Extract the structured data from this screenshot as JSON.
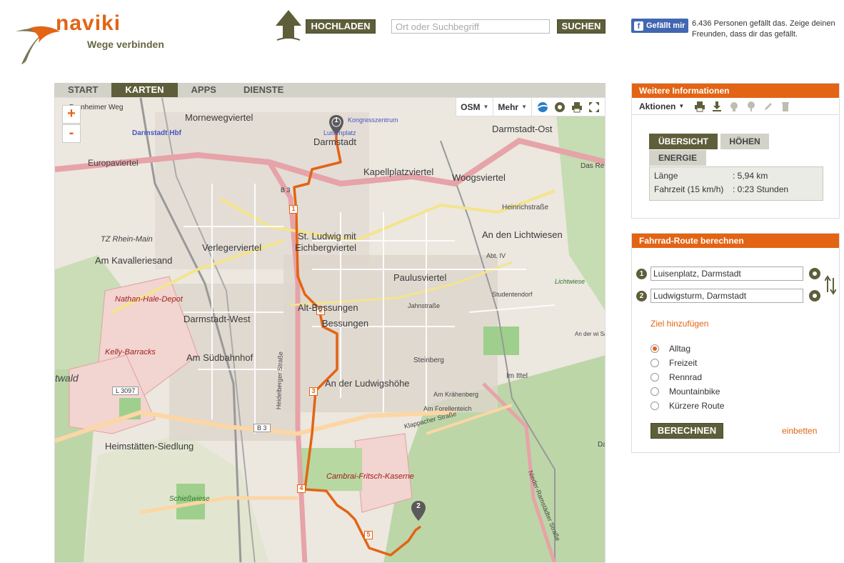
{
  "header": {
    "logo_text": "naviki",
    "logo_tagline": "Wege verbinden",
    "upload_label": "HOCHLADEN",
    "search_placeholder": "Ort oder Suchbegriff",
    "search_label": "SUCHEN",
    "fb_like_label": "Gefällt mir",
    "fb_text": "6.436 Personen gefällt das. Zeige deinen Freunden, dass dir das gefällt."
  },
  "nav": {
    "tabs": [
      "START",
      "KARTEN",
      "APPS",
      "DIENSTE"
    ],
    "active_tab": "KARTEN"
  },
  "map": {
    "layer_label": "OSM",
    "more_label": "Mehr",
    "zoom_in": "+",
    "zoom_out": "-",
    "route_color": "#e36414",
    "labels": {
      "darmstadt": "Darmstadt",
      "darmstadt_ost": "Darmstadt-Ost",
      "mornewegviertel": "Mornewegviertel",
      "kapellplatzviertel": "Kapellplatzviertel",
      "woogsviertel": "Woogsviertel",
      "verlegerviertel": "Verlegerviertel",
      "st_ludwig": "St. Ludwig mit",
      "eichbergviertel": "Eichbergviertel",
      "an_den_lichtwiesen": "An den Lichtwiesen",
      "paulusviertel": "Paulusviertel",
      "am_kavalleriesand": "Am Kavalleriesand",
      "darmstadt_west": "Darmstadt-West",
      "alt_bessungen": "Alt-Bessungen",
      "bessungen": "Bessungen",
      "am_suedbahnhof": "Am Südbahnhof",
      "an_der_ludwigshoehe": "An der Ludwigshöhe",
      "heimstaetten": "Heimstätten-Siedlung",
      "nathan_hale": "Nathan-Hale-Depot",
      "kelly_barracks": "Kelly-Barracks",
      "cambrai": "Cambrai-Fritsch-Kaserne",
      "tz_rhein_main": "TZ Rhein-Main",
      "europaviertel": "Europaviertel",
      "darmstadt_hbf": "Darmstadt Hbf",
      "dornheimer_weg": "Dornheimer Weg",
      "heinrichstrasse": "Heinrichstraße",
      "jahnstrasse": "Jahnstraße",
      "klappacher": "Klappacher Straße",
      "steinberg": "Steinberg",
      "studentendorf": "Studentendorf",
      "im_ittel": "Im Ittel",
      "am_kraehenberg": "Am Krähenberg",
      "am_forellenteich": "Am Forellenteich",
      "schiesswiese": "Schießwiese",
      "twald": "twald",
      "l3097": "L 3097",
      "b3_top": "B 3",
      "b3_bottom": "B 3",
      "heidelberger": "Heidelberger Straße",
      "nieder_ramstaedter": "Nieder-Ramstädter Straße",
      "luisenplatz": "Luisenplatz",
      "kongresszentrum": "Kongresszentrum",
      "das_reih": "Das Reih",
      "an_der_wiss": "An der wi Säu und Vorderwi",
      "lichtwiese": "Lichtwiese",
      "abt_iv": "Abt. IV",
      "dach": "Dach"
    },
    "route_waypoints": [
      "1",
      "2",
      "3",
      "4",
      "5"
    ],
    "pin_start": "1",
    "pin_end": "2"
  },
  "info_panel": {
    "title": "Weitere Informationen",
    "actions_label": "Aktionen",
    "tabs": [
      "ÜBERSICHT",
      "HÖHEN",
      "ENERGIE"
    ],
    "active_tab": "ÜBERSICHT",
    "stats": [
      {
        "label": "Länge",
        "value": ": 5,94 km"
      },
      {
        "label": "Fahrzeit (15 km/h)",
        "value": ": 0:23 Stunden"
      }
    ]
  },
  "route_panel": {
    "title": "Fahrrad-Route berechnen",
    "start_num": "1",
    "end_num": "2",
    "start_value": "Luisenplatz, Darmstadt",
    "end_value": "Ludwigsturm, Darmstadt",
    "add_destination": "Ziel hinzufügen",
    "options": [
      "Alltag",
      "Freizeit",
      "Rennrad",
      "Mountainbike",
      "Kürzere Route"
    ],
    "selected_option": "Alltag",
    "calculate_label": "BERECHNEN",
    "embed_label": "einbetten"
  }
}
